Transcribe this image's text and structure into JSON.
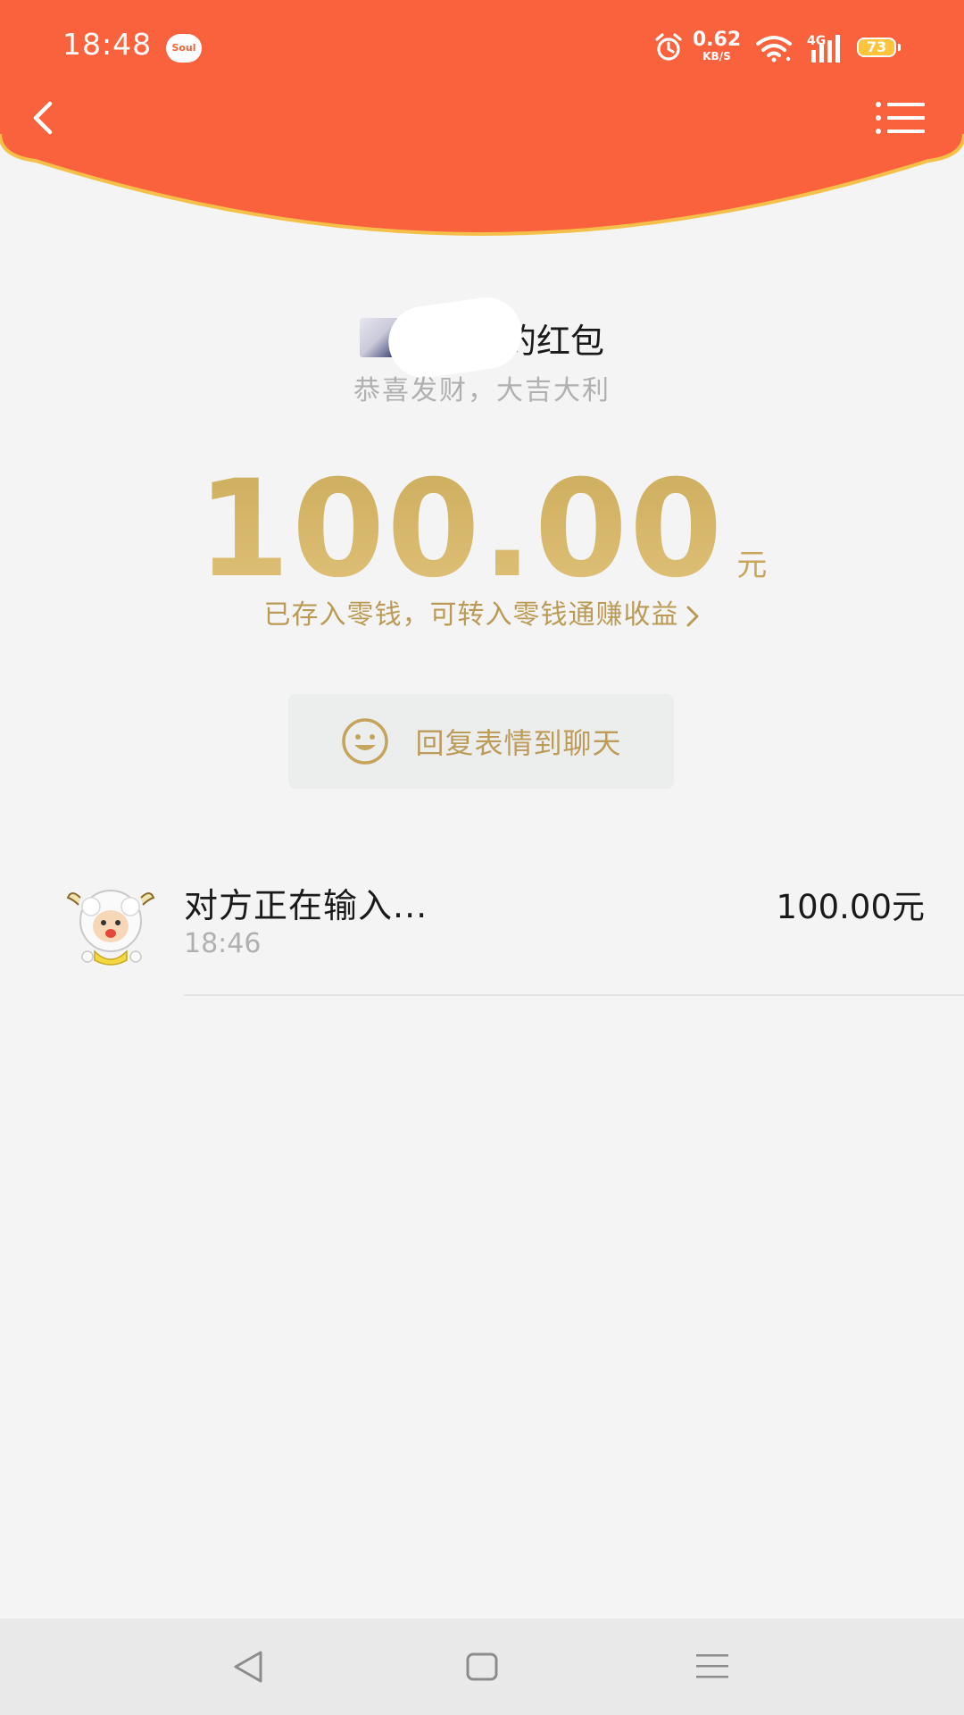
{
  "status_bar": {
    "time": "18:48",
    "app_badge": "Soul",
    "net_speed_value": "0.62",
    "net_speed_unit": "KB/S",
    "network_type": "4G",
    "battery": "73"
  },
  "header": {
    "back_icon": "chevron-left-icon",
    "menu_icon": "list-menu-icon",
    "color": "#f9623c",
    "border_color": "#f4c04a"
  },
  "packet": {
    "sender_title": "的红包",
    "blessing": "恭喜发财，大吉大利",
    "amount": "100.00",
    "unit": "元",
    "deposit_note": "已存入零钱，可转入零钱通赚收益",
    "gold_color": "#c9a65b"
  },
  "reply": {
    "label": "回复表情到聊天",
    "icon": "smile-icon"
  },
  "records": [
    {
      "name": "对方正在输入...",
      "time": "18:46",
      "amount": "100.00元"
    }
  ],
  "nav": {
    "back": "triangle-back-icon",
    "home": "square-home-icon",
    "recent": "lines-menu-icon"
  }
}
